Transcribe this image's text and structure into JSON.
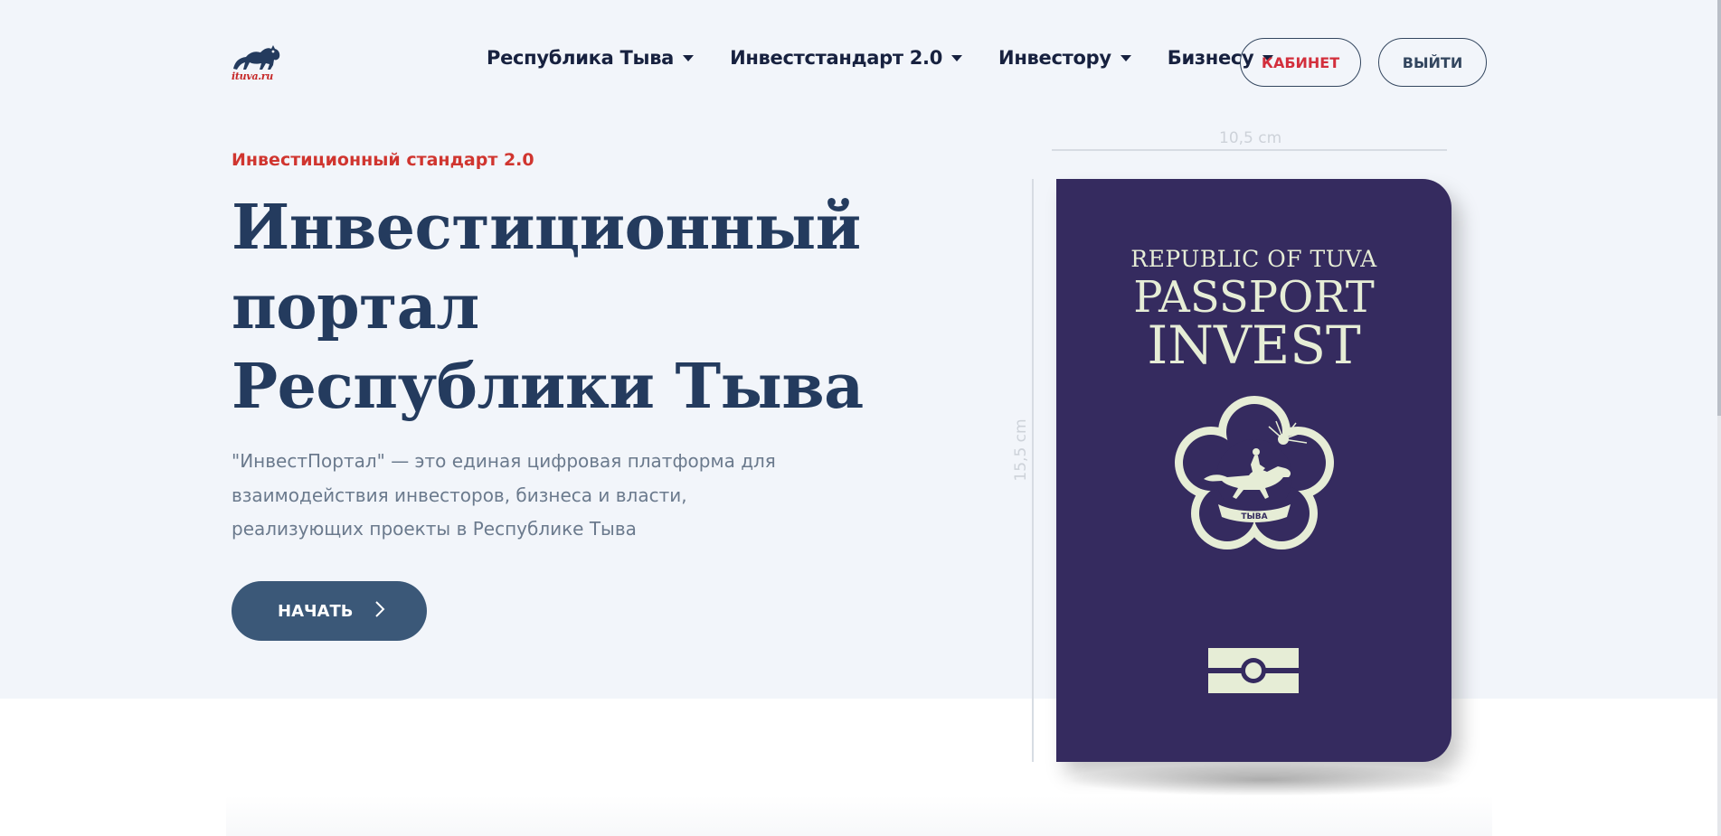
{
  "header": {
    "logo_text": "ituva.ru",
    "nav": [
      {
        "label": "Республика Тыва"
      },
      {
        "label": "Инвестстандарт 2.0"
      },
      {
        "label": "Инвестору"
      },
      {
        "label": "Бизнесу"
      }
    ],
    "cabinet_label": "КАБИНЕТ",
    "logout_label": "ВЫЙТИ"
  },
  "hero": {
    "eyebrow": "Инвестиционный стандарт 2.0",
    "title_lines": [
      "Инвестиционный",
      "портал",
      "Республики Тыва"
    ],
    "description": "\"ИнвестПортал\" — это единая цифровая платформа для взаимодействия инвесторов, бизнеса и власти, реализующих проекты в Республике Тыва",
    "start_label": "НАЧАТЬ"
  },
  "passport": {
    "width_label": "10,5 cm",
    "height_label": "15,5 cm",
    "line1": "REPUBLIC OF TUVA",
    "line2": "PASSPORT",
    "line3": "INVEST",
    "emblem_ribbon": "ТЫВА"
  },
  "colors": {
    "accent_red": "#d0352f",
    "navy": "#243b5e",
    "button_blue": "#3b5878",
    "passport_purple": "#352b5f",
    "passport_ink": "#e6edd6"
  }
}
